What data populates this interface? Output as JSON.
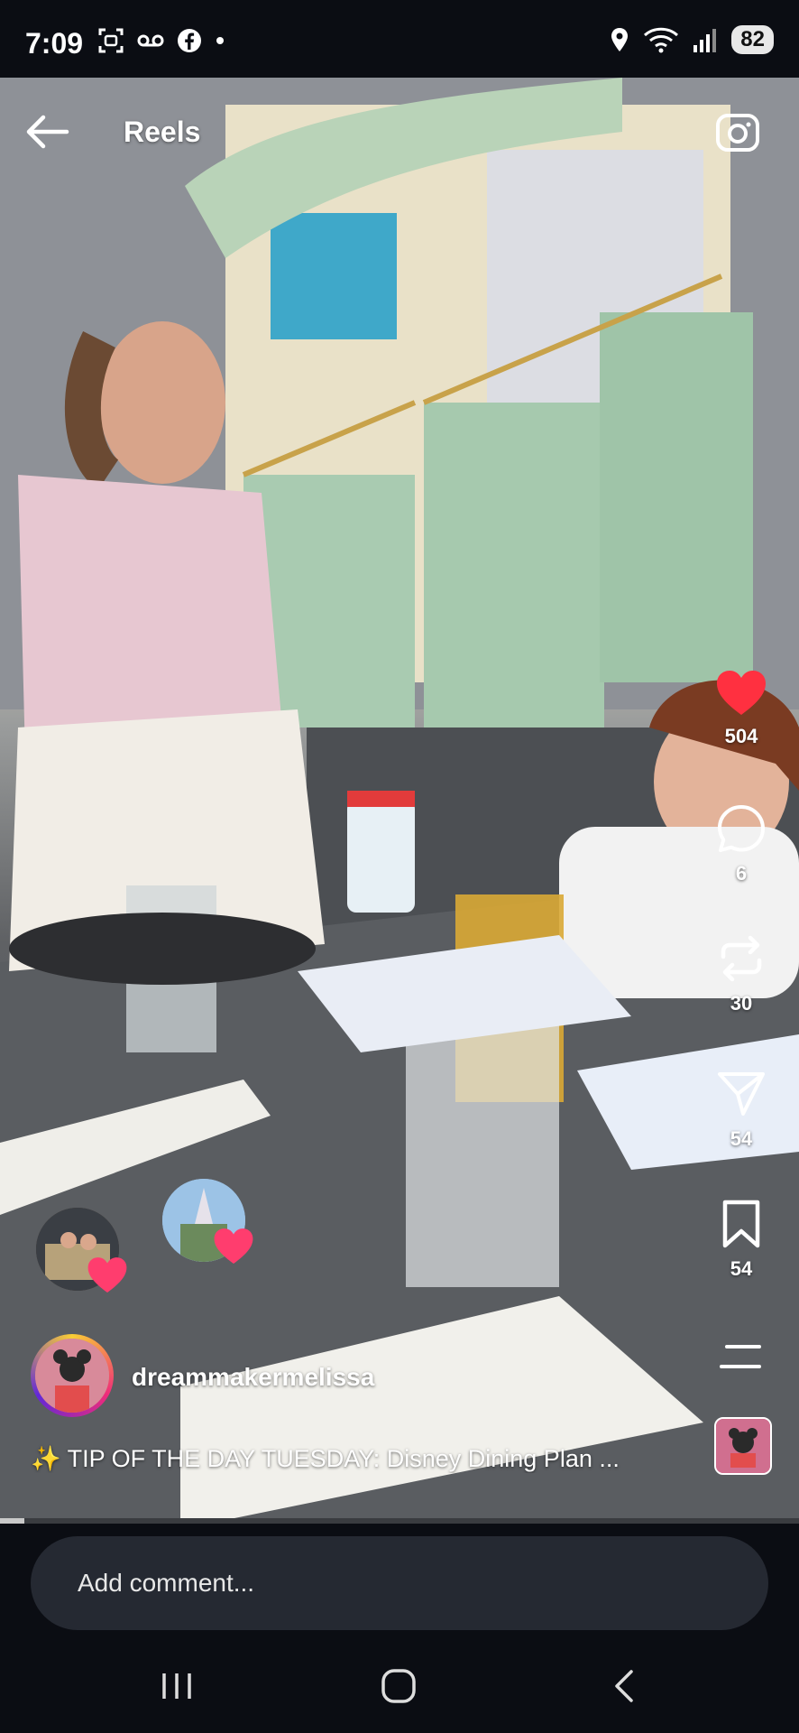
{
  "status_bar": {
    "time": "7:09",
    "battery": "82",
    "icons_left": [
      "screenshot-icon",
      "voicemail-icon",
      "facebook-icon",
      "dot-icon"
    ],
    "icons_right": [
      "location-icon",
      "wifi-icon",
      "signal-icon",
      "battery-icon"
    ]
  },
  "header": {
    "title": "Reels",
    "back_icon": "arrow-left-icon",
    "camera_icon": "camera-icon"
  },
  "actions": {
    "likes": "504",
    "comments": "6",
    "reposts": "30",
    "shares": "54",
    "saves": "54",
    "like_color": "#ff3040"
  },
  "post": {
    "username": "dreammakermelissa",
    "caption": "✨ TIP OF THE DAY TUESDAY: Disney Dining Plan ..."
  },
  "progress": {
    "fraction": 0.03
  },
  "comment": {
    "placeholder": "Add comment..."
  },
  "nav": [
    "recents-icon",
    "home-icon",
    "back-icon"
  ]
}
